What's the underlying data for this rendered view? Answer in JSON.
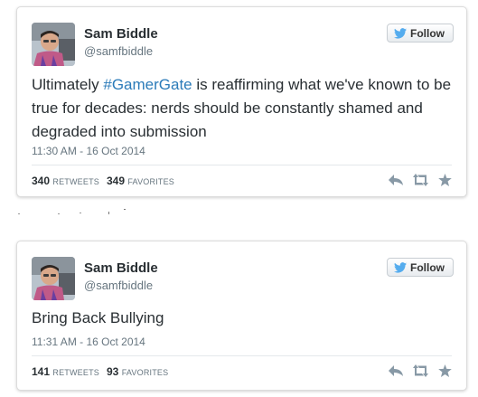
{
  "tweets": [
    {
      "author": {
        "name": "Sam Biddle",
        "handle": "@samfbiddle"
      },
      "follow_label": "Follow",
      "text": {
        "before": "Ultimately ",
        "hashtag": "#GamerGate",
        "after": " is reaffirming what we've known to be true for decades: nerds should be constantly shamed and degraded into submission"
      },
      "timestamp": "11:30 AM - 16 Oct 2014",
      "retweets": {
        "count": "340",
        "label": "RETWEETS"
      },
      "favorites": {
        "count": "349",
        "label": "FAVORITES"
      }
    },
    {
      "author": {
        "name": "Sam Biddle",
        "handle": "@samfbiddle"
      },
      "follow_label": "Follow",
      "text": {
        "before": "Bring Back Bullying",
        "hashtag": "",
        "after": ""
      },
      "timestamp": "11:31 AM - 16 Oct 2014",
      "retweets": {
        "count": "141",
        "label": "RETWEETS"
      },
      "favorites": {
        "count": "93",
        "label": "FAVORITES"
      }
    }
  ],
  "colors": {
    "hashtag": "#2b7bb9",
    "twitter_bird": "#55acee",
    "action_icons": "#8899a6"
  },
  "icons": [
    "twitter-bird-icon",
    "reply-icon",
    "retweet-icon",
    "favorite-star-icon"
  ]
}
